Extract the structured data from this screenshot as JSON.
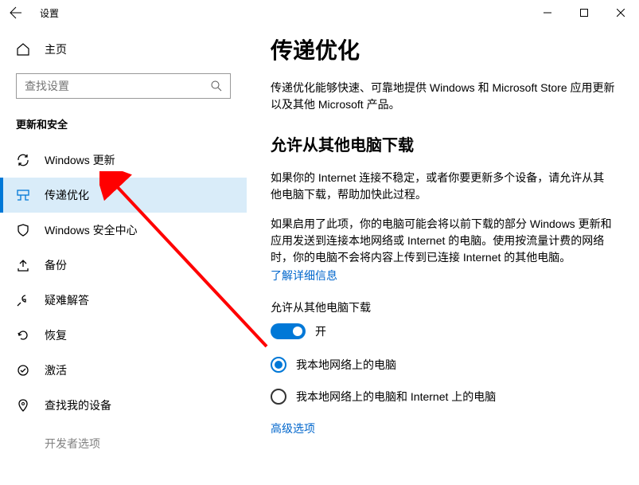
{
  "window": {
    "title": "设置"
  },
  "sidebar": {
    "home": "主页",
    "search_placeholder": "查找设置",
    "section": "更新和安全",
    "items": [
      {
        "label": "Windows 更新",
        "icon": "sync"
      },
      {
        "label": "传递优化",
        "icon": "delivery"
      },
      {
        "label": "Windows 安全中心",
        "icon": "shield"
      },
      {
        "label": "备份",
        "icon": "backup"
      },
      {
        "label": "疑难解答",
        "icon": "troubleshoot"
      },
      {
        "label": "恢复",
        "icon": "recovery"
      },
      {
        "label": "激活",
        "icon": "activation"
      },
      {
        "label": "查找我的设备",
        "icon": "find"
      },
      {
        "label": "开发者选项",
        "icon": "developer"
      }
    ],
    "active_index": 1
  },
  "main": {
    "title": "传递优化",
    "intro": "传递优化能够快速、可靠地提供 Windows 和 Microsoft Store 应用更新以及其他 Microsoft 产品。",
    "section_heading": "允许从其他电脑下载",
    "para1": "如果你的 Internet 连接不稳定，或者你要更新多个设备，请允许从其他电脑下载，帮助加快此过程。",
    "para2": "如果启用了此项，你的电脑可能会将以前下载的部分 Windows 更新和应用发送到连接本地网络或 Internet 的电脑。使用按流量计费的网络时，你的电脑不会将内容上传到已连接 Internet 的其他电脑。",
    "learn_more": "了解详细信息",
    "toggle_label": "允许从其他电脑下载",
    "toggle_state": "开",
    "radio1": "我本地网络上的电脑",
    "radio2": "我本地网络上的电脑和 Internet 上的电脑",
    "advanced": "高级选项"
  }
}
